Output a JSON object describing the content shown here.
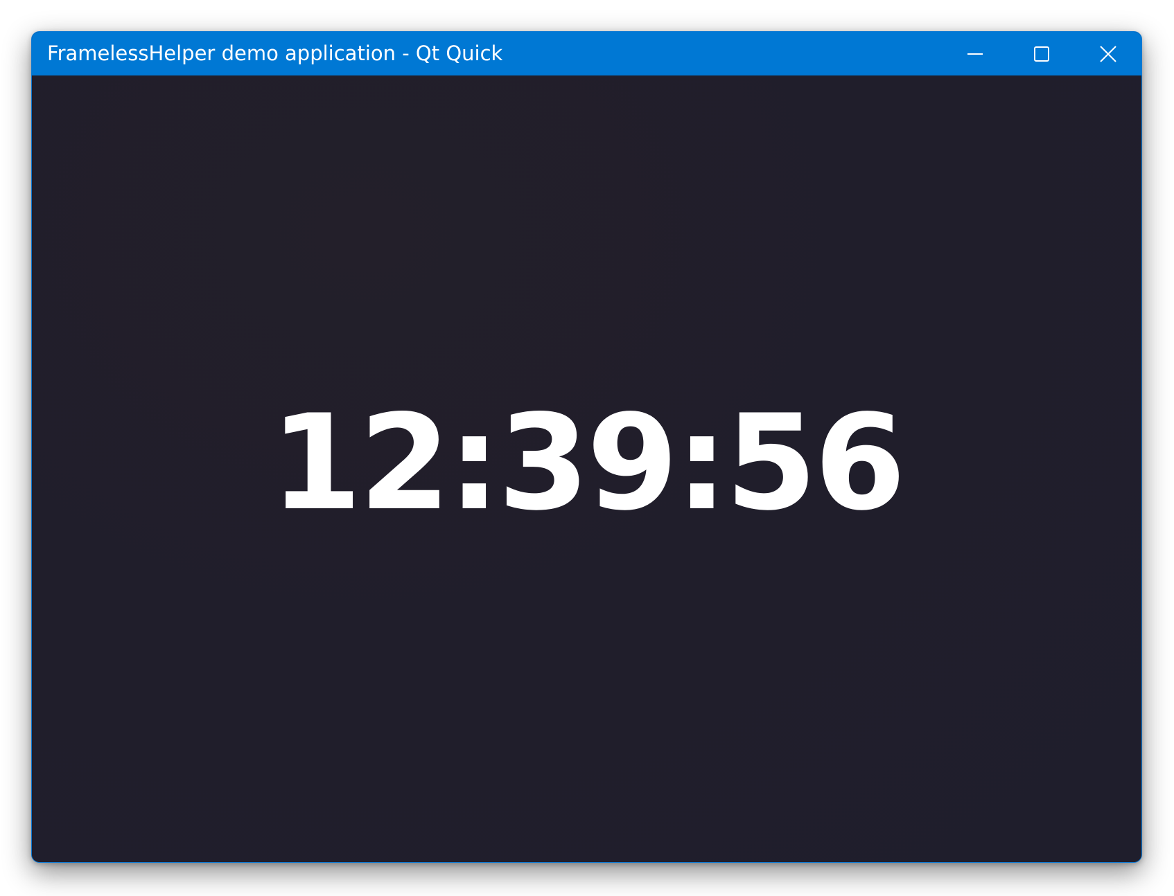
{
  "window": {
    "title": "FramelessHelper demo application - Qt Quick",
    "accent_color": "#0078d4",
    "background_color": "#201f2b"
  },
  "caption_buttons": {
    "minimize_icon": "minimize-icon",
    "maximize_icon": "maximize-icon",
    "close_icon": "close-icon"
  },
  "clock": {
    "time": "12:39:56",
    "color": "#ffffff"
  }
}
